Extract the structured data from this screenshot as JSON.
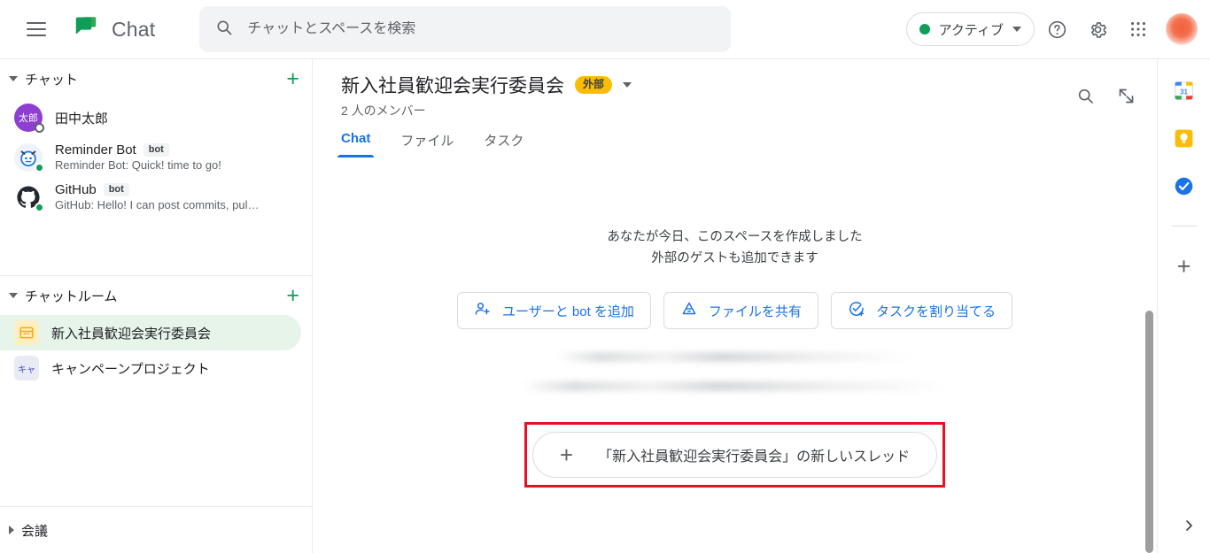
{
  "topbar": {
    "menu_label": "menu",
    "app_name": "Chat",
    "search_placeholder": "チャットとスペースを検索",
    "search_value": "",
    "status_label": "アクティブ",
    "status_color": "#0f9d58",
    "help_label": "?",
    "settings_label": "settings",
    "apps_label": "Google apps"
  },
  "sidebar": {
    "chat_section": {
      "title": "チャット",
      "add_label": "+",
      "items": [
        {
          "name": "田中太郎",
          "avatar_text": "太郎",
          "avatar_color": "#8e3fd1",
          "presence": "away",
          "tag": "",
          "preview": ""
        },
        {
          "name": "Reminder Bot",
          "avatar_text": "",
          "avatar_color": "#e8f0fe",
          "presence": "active",
          "tag": "bot",
          "preview": "Reminder Bot: Quick! time to go!"
        },
        {
          "name": "GitHub",
          "avatar_text": "",
          "avatar_color": "#ffffff",
          "presence": "active",
          "tag": "bot",
          "preview": "GitHub: Hello! I can post commits, pul…"
        }
      ]
    },
    "rooms_section": {
      "title": "チャットルーム",
      "add_label": "+",
      "items": [
        {
          "name": "新入社員歓迎会実行委員会",
          "icon_text": "",
          "icon_bg": "#feefc3",
          "icon_fg": "#f9ab00",
          "selected": true
        },
        {
          "name": "キャンペーンプロジェクト",
          "icon_text": "キャ",
          "icon_bg": "#e8eaf6",
          "icon_fg": "#3f51b5",
          "selected": false
        }
      ]
    },
    "meetings_section": {
      "title": "会議"
    }
  },
  "conversation": {
    "title": "新入社員歓迎会実行委員会",
    "badge": "外部",
    "badge_color": "#fbbc04",
    "members": "2 人のメンバー",
    "tabs": [
      {
        "label": "Chat",
        "active": true
      },
      {
        "label": "ファイル",
        "active": false
      },
      {
        "label": "タスク",
        "active": false
      }
    ],
    "active_tab_color": "#1a73e8",
    "header_actions": [
      "search-icon",
      "collapse-icon"
    ]
  },
  "main": {
    "intro_line1": "あなたが今日、このスペースを作成しました",
    "intro_line2": "外部のゲストも追加できます",
    "cta_buttons": [
      {
        "icon": "person-add-icon",
        "label": "ユーザーと bot を追加"
      },
      {
        "icon": "drive-icon",
        "label": "ファイルを共有"
      },
      {
        "icon": "task-add-icon",
        "label": "タスクを割り当てる"
      }
    ],
    "redacted_lines": 2,
    "new_thread": {
      "plus": "+",
      "label": "「新入社員歓迎会実行委員会」の新しいスレッド",
      "highlight_color": "#e81123"
    }
  },
  "right_rail": {
    "items": [
      {
        "name": "google-calendar-icon",
        "label": "31"
      },
      {
        "name": "google-keep-icon",
        "label": ""
      },
      {
        "name": "google-tasks-icon",
        "label": ""
      }
    ],
    "add_label": "+",
    "expand_label": "›"
  }
}
